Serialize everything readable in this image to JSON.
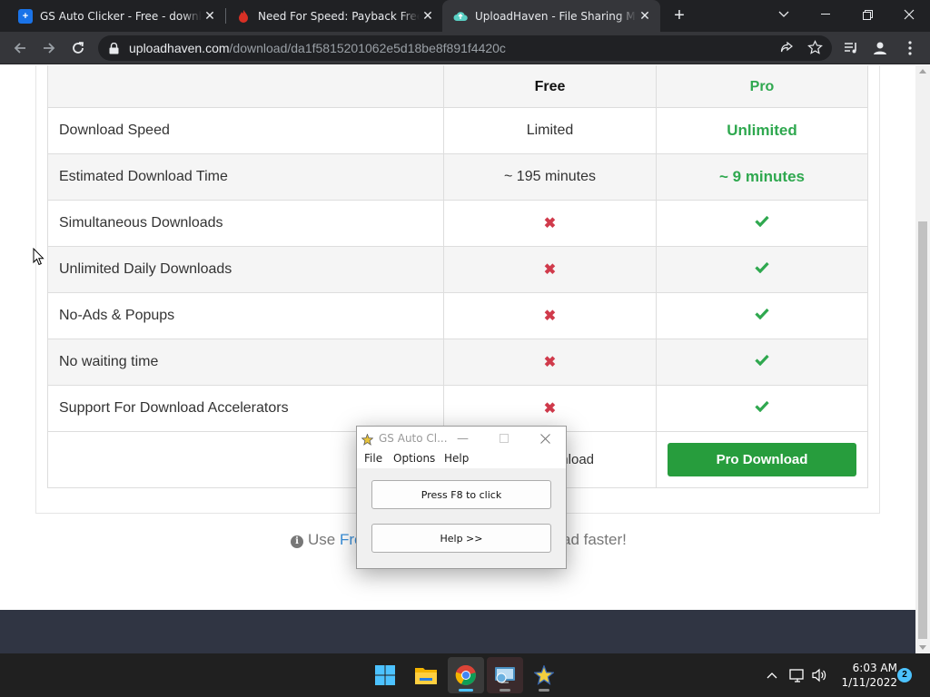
{
  "browser": {
    "tabs": [
      {
        "title": "GS Auto Clicker - Free - downloa",
        "favicon": "gs-auto-clicker-favicon",
        "color": "#1a73e8"
      },
      {
        "title": "Need For Speed: Payback Free Do",
        "favicon": "nfs-favicon",
        "color": "#c5221f"
      },
      {
        "title": "UploadHaven - File Sharing Made",
        "favicon": "uploadhaven-favicon",
        "color": "#5ad0c4",
        "active": true
      }
    ],
    "url": {
      "host": "uploadhaven.com",
      "path": "/download/da1f5815201062e5d18be8f891f4420c"
    }
  },
  "comparison": {
    "headers": {
      "free": "Free",
      "pro": "Pro"
    },
    "rows": [
      {
        "feature": "Download Speed",
        "free": "Limited",
        "pro": "Unlimited"
      },
      {
        "feature": "Estimated Download Time",
        "free": "~ 195 minutes",
        "pro": "~ 9 minutes"
      },
      {
        "feature": "Simultaneous Downloads",
        "free": "x",
        "pro": "check"
      },
      {
        "feature": "Unlimited Daily Downloads",
        "free": "x",
        "pro": "check"
      },
      {
        "feature": "No-Ads & Popups",
        "free": "x",
        "pro": "check"
      },
      {
        "feature": "No waiting time",
        "free": "x",
        "pro": "check"
      },
      {
        "feature": "Support For Download Accelerators",
        "free": "x",
        "pro": "check"
      }
    ],
    "free_download_partial": "nload",
    "pro_download_label": "Pro Download"
  },
  "tip": {
    "lead": "Use ",
    "link_partial": "Fre",
    "tail_partial": "ad faster!"
  },
  "gs_window": {
    "title": "GS Auto Cl...",
    "menu": [
      "File",
      "Options",
      "Help"
    ],
    "click_button": "Press F8 to click",
    "help_button": "Help >>"
  },
  "taskbar": {
    "apps": [
      "start-icon",
      "file-explorer-icon",
      "chrome-icon",
      "remote-app-icon",
      "gs-auto-clicker-icon"
    ],
    "time": "6:03 AM",
    "date": "1/11/2022",
    "notifications": "2"
  },
  "colors": {
    "pro_green": "#2fa84f",
    "button_green": "#279d3d",
    "x_red": "#d03a4b",
    "footer": "#303543"
  }
}
